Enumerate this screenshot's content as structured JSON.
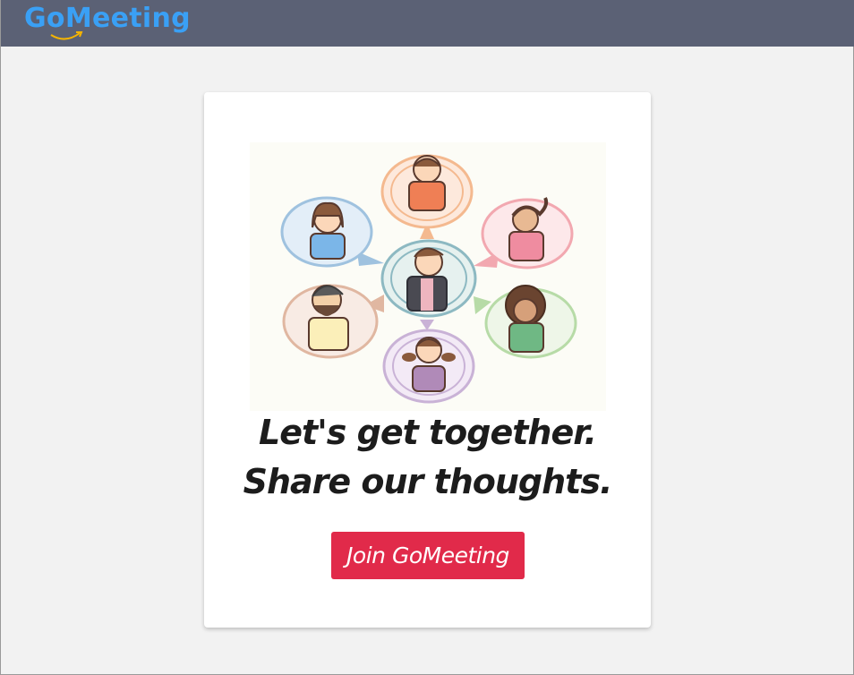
{
  "header": {
    "brand_go": "Go",
    "brand_meeting": "Meeting",
    "brand_color": "#3aa0f5",
    "bar_color": "#5b6175"
  },
  "hero": {
    "illustration_icon": "people-chat-illustration",
    "tagline_line1": "Let's get together.",
    "tagline_line2": "Share our thoughts.",
    "join_label": "Join GoMeeting",
    "button_color": "#e12a4a"
  }
}
